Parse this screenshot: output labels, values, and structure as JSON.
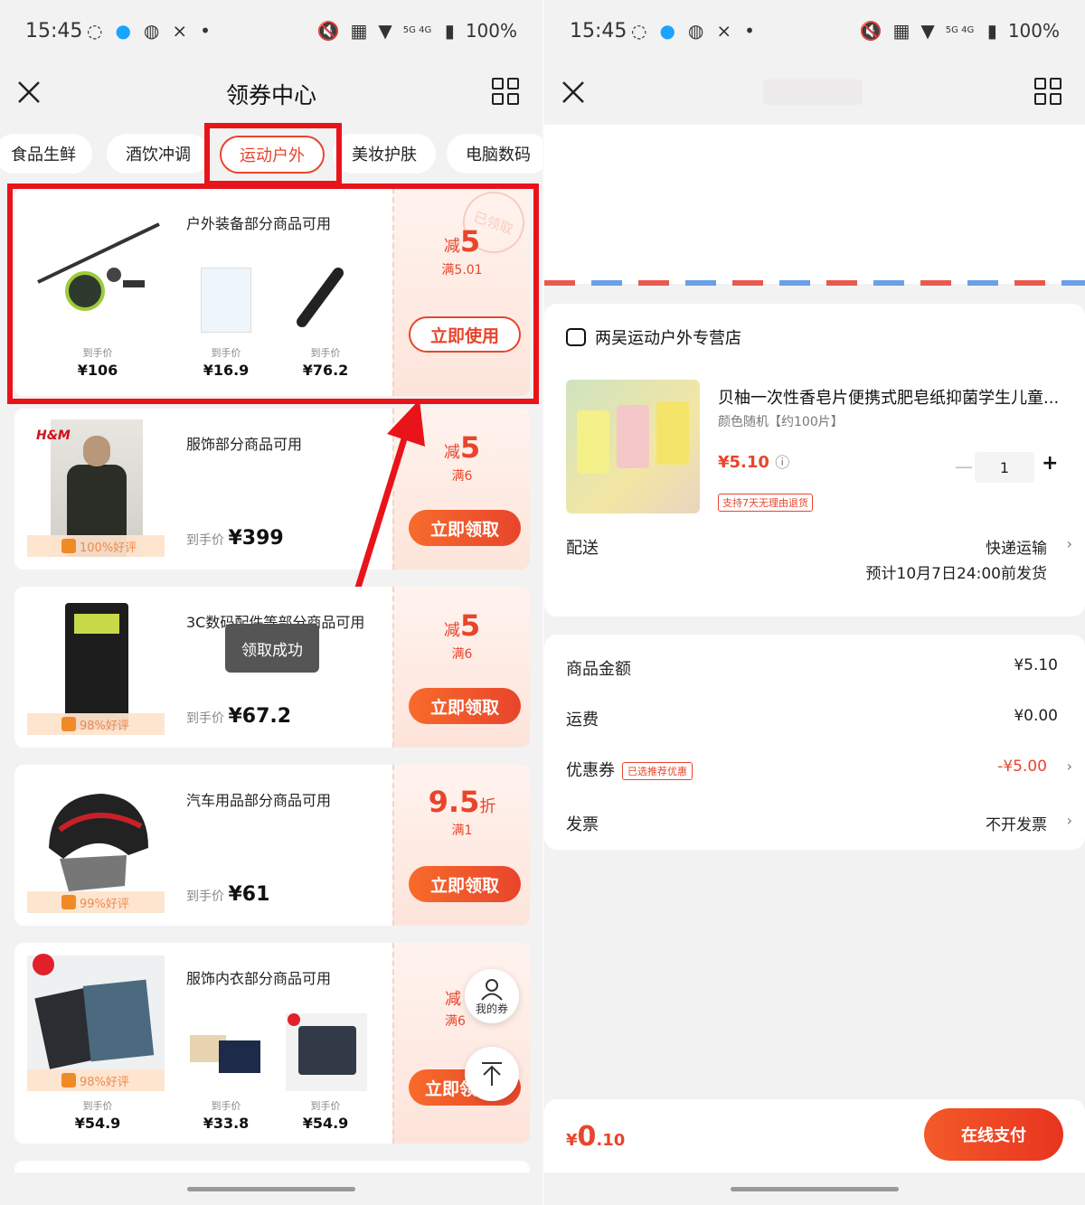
{
  "status": {
    "time": "15:45",
    "battery": "100%",
    "net": "5G 4G"
  },
  "left": {
    "title": "领券中心",
    "tabs": [
      "食品生鲜",
      "酒饮冲调",
      "运动户外",
      "美妆护肤",
      "电脑数码"
    ],
    "active_tab": "运动户外",
    "cards": [
      {
        "condition": "户外装备部分商品可用",
        "prefix": "减",
        "amount": "5",
        "min": "满5.01",
        "button": "立即使用",
        "stamp": "已领取",
        "products": [
          {
            "label": "到手价",
            "price": "¥106"
          },
          {
            "label": "到手价",
            "price": "¥16.9"
          },
          {
            "label": "到手价",
            "price": "¥76.2"
          }
        ]
      },
      {
        "condition": "服饰部分商品可用",
        "prefix": "减",
        "amount": "5",
        "min": "满6",
        "button": "立即领取",
        "rating": "100%好评",
        "price_label": "到手价",
        "price": "¥399",
        "brand": "H&M"
      },
      {
        "condition": "3C数码配件等部分商品可用",
        "prefix": "减",
        "amount": "5",
        "min": "满6",
        "button": "立即领取",
        "rating": "98%好评",
        "price_label": "到手价",
        "price": "¥67.2"
      },
      {
        "condition": "汽车用品部分商品可用",
        "amount": "9.5",
        "suffix": "折",
        "min": "满1",
        "button": "立即领取",
        "rating": "99%好评",
        "price_label": "到手价",
        "price": "¥61"
      },
      {
        "condition": "服饰内衣部分商品可用",
        "prefix": "减",
        "min": "满6",
        "button": "立即领取",
        "rating": "98%好评",
        "products": [
          {
            "label": "到手价",
            "price": "¥54.9"
          },
          {
            "label": "到手价",
            "price": "¥33.8"
          },
          {
            "label": "到手价",
            "price": "¥54.9"
          }
        ]
      }
    ],
    "toast": "领取成功",
    "my_coupons": "我的券"
  },
  "right": {
    "shop": "两吴运动户外专营店",
    "product_title": "贝柚一次性香皂片便携式肥皂纸抑菌学生儿童...",
    "product_spec": "颜色随机【约100片】",
    "product_price": "¥5.10",
    "return_badge": "支持7天无理由退货",
    "quantity": "1",
    "delivery_label": "配送",
    "delivery_method": "快递运输",
    "delivery_eta": "预计10月7日24:00前发货",
    "rows": [
      {
        "label": "商品金额",
        "value": "¥5.10"
      },
      {
        "label": "运费",
        "value": "¥0.00"
      },
      {
        "label": "优惠券",
        "badge": "已选推荐优惠",
        "value": "-¥5.00"
      },
      {
        "label": "发票",
        "value": "不开发票"
      }
    ],
    "total_currency": "¥",
    "total_int": "0",
    "total_dec": ".10",
    "pay_button": "在线支付"
  },
  "colors": {
    "accent": "#e8452c",
    "highlight": "#e8141a"
  }
}
